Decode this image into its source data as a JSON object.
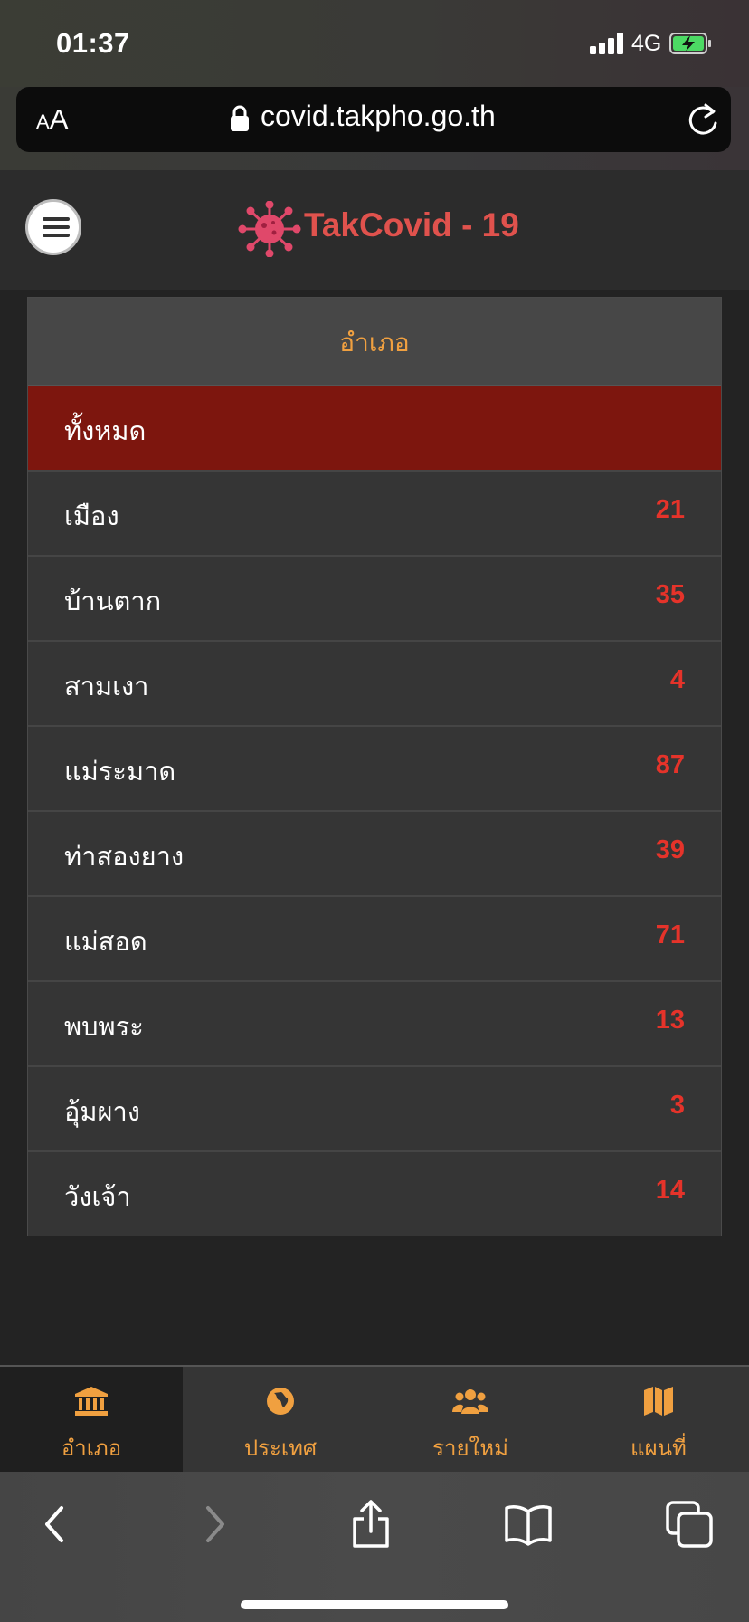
{
  "status_bar": {
    "time": "01:37",
    "network": "4G",
    "icons": [
      "signal-icon",
      "battery-charging-icon"
    ]
  },
  "url_bar": {
    "text_size_label_small": "A",
    "text_size_label_big": "A",
    "url": "covid.takpho.go.th",
    "icons": [
      "lock-icon",
      "reload-icon"
    ]
  },
  "header": {
    "logo_text": "TakCovid - 19",
    "logo_color": "#e0524d",
    "icons": [
      "menu-icon",
      "virus-icon"
    ]
  },
  "district_table": {
    "heading": "อำเภอ",
    "active_color": "#7d160e",
    "rows": [
      {
        "name": "ทั้งหมด",
        "count": ""
      },
      {
        "name": "เมือง",
        "count": "21"
      },
      {
        "name": "บ้านตาก",
        "count": "35"
      },
      {
        "name": "สามเงา",
        "count": "4"
      },
      {
        "name": "แม่ระมาด",
        "count": "87"
      },
      {
        "name": "ท่าสองยาง",
        "count": "39"
      },
      {
        "name": "แม่สอด",
        "count": "71"
      },
      {
        "name": "พบพระ",
        "count": "13"
      },
      {
        "name": "อุ้มผาง",
        "count": "3"
      },
      {
        "name": "วังเจ้า",
        "count": "14"
      }
    ]
  },
  "tab_bar": {
    "accent_color": "#f0a040",
    "tabs": [
      {
        "label": "อำเภอ",
        "icon": "landmark-icon",
        "active": true
      },
      {
        "label": "ประเทศ",
        "icon": "globe-icon",
        "active": false
      },
      {
        "label": "รายใหม่",
        "icon": "users-icon",
        "active": false
      },
      {
        "label": "แผนที่",
        "icon": "map-icon",
        "active": false
      }
    ]
  },
  "browser_toolbar": {
    "buttons": [
      "back-icon",
      "forward-icon",
      "share-icon",
      "bookmarks-icon",
      "tabs-icon"
    ]
  }
}
